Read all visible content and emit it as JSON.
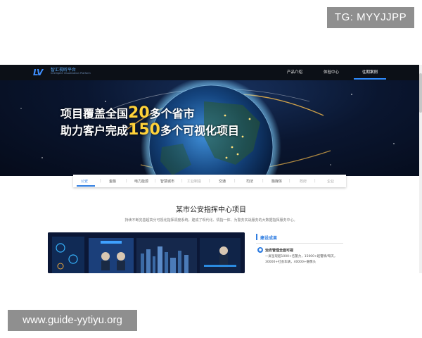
{
  "watermarks": {
    "top": "TG: MYYJJPP",
    "bottom": "www.guide-yytiyu.org"
  },
  "header": {
    "logo_mark": "LV",
    "logo_name": "智汇视听平台",
    "logo_sub": "Intelligent Visualization Platform",
    "nav": [
      {
        "label": "产品介绍",
        "active": false
      },
      {
        "label": "体验中心",
        "active": false
      },
      {
        "label": "往期案例",
        "active": true
      }
    ],
    "accent_color": "#2f8cff"
  },
  "hero": {
    "line1": {
      "pre": "项目覆盖全国",
      "num": "20",
      "post": "多个省市"
    },
    "line2": {
      "pre": "助力客户完成",
      "num": "150",
      "post": "多个可视化项目"
    },
    "highlight_color": "#ffd23a"
  },
  "tabs": [
    {
      "label": "公安",
      "state": "active"
    },
    {
      "label": "金融",
      "state": "normal"
    },
    {
      "label": "电力能源",
      "state": "normal"
    },
    {
      "label": "智慧城市",
      "state": "normal"
    },
    {
      "label": "工业制造",
      "state": "muted"
    },
    {
      "label": "交通",
      "state": "normal"
    },
    {
      "label": "司法",
      "state": "normal"
    },
    {
      "label": "融媒体",
      "state": "normal"
    },
    {
      "label": "政府",
      "state": "muted"
    },
    {
      "label": "企业",
      "state": "muted"
    }
  ],
  "section": {
    "title": "某市公安指挥中心项目",
    "description": "持续不断完善超高分可视化指挥调度系统，建成了现代化、情指一体、为警务实战服务的大数据指挥服务中心。"
  },
  "info": {
    "heading": "建设成果",
    "subheading": "治安管理全面可视",
    "icon": "person-icon",
    "lines": [
      "一屏呈现超1000+名警力，15000+起警情/每天，",
      "30000+社会车辆，40000+摄像头"
    ]
  }
}
